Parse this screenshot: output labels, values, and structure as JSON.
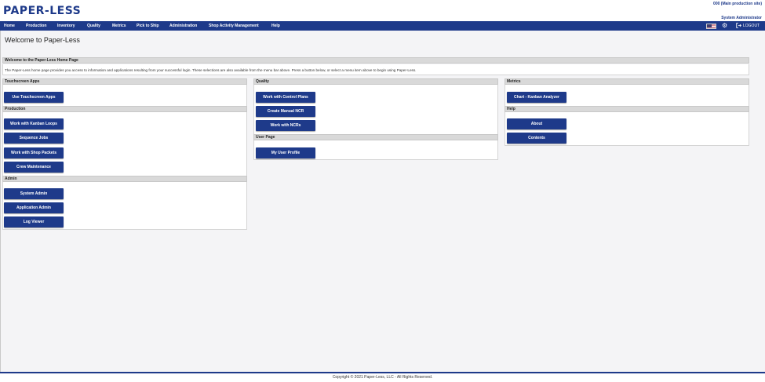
{
  "app": {
    "logo": "PAPER-LESS",
    "site": "000 (Main production site)",
    "user": "System Administrator"
  },
  "menu": [
    "Home",
    "Production",
    "Inventory",
    "Quality",
    "Metrics",
    "Pick to Ship",
    "Administration",
    "Shop Activity Management",
    "Help"
  ],
  "logout_label": "LOGOUT",
  "page_title": "Welcome to Paper-Less",
  "welcome": {
    "heading": "Welcome to the Paper-Less Home Page",
    "text": "The Paper-Less home page provides you access to information and applications resulting from your successful login. These selections are also available from the menu bar above. Press a button below, or select a menu item above to begin using Paper-Less."
  },
  "sections": {
    "touchscreen": {
      "heading": "Touchscreen Apps",
      "buttons": [
        "Use Touchscreen Apps"
      ]
    },
    "production": {
      "heading": "Production",
      "buttons": [
        "Work with Kanban Loops",
        "Sequence Jobs",
        "Work with Shop Packets",
        "Crew Maintenance"
      ]
    },
    "admin": {
      "heading": "Admin",
      "buttons": [
        "System Admin",
        "Application Admin",
        "Log Viewer"
      ]
    },
    "quality": {
      "heading": "Quality",
      "buttons": [
        "Work with Control Plans",
        "Create Manual NCR",
        "Work with NCRs"
      ]
    },
    "userpage": {
      "heading": "User Page",
      "buttons": [
        "My User Profile"
      ]
    },
    "metrics": {
      "heading": "Metrics",
      "buttons": [
        "Chart - Kanban Analyzer"
      ]
    },
    "help": {
      "heading": "Help",
      "buttons": [
        "About",
        "Contents"
      ]
    }
  },
  "footer": "Copyright © 2021 Paper-Less, LLC - All Rights Reserved.",
  "colors": {
    "brand": "#1e3a8a",
    "section_bar": "#d9d9d9"
  },
  "icons": [
    "us-flag-icon",
    "gear-icon",
    "logout-icon"
  ]
}
